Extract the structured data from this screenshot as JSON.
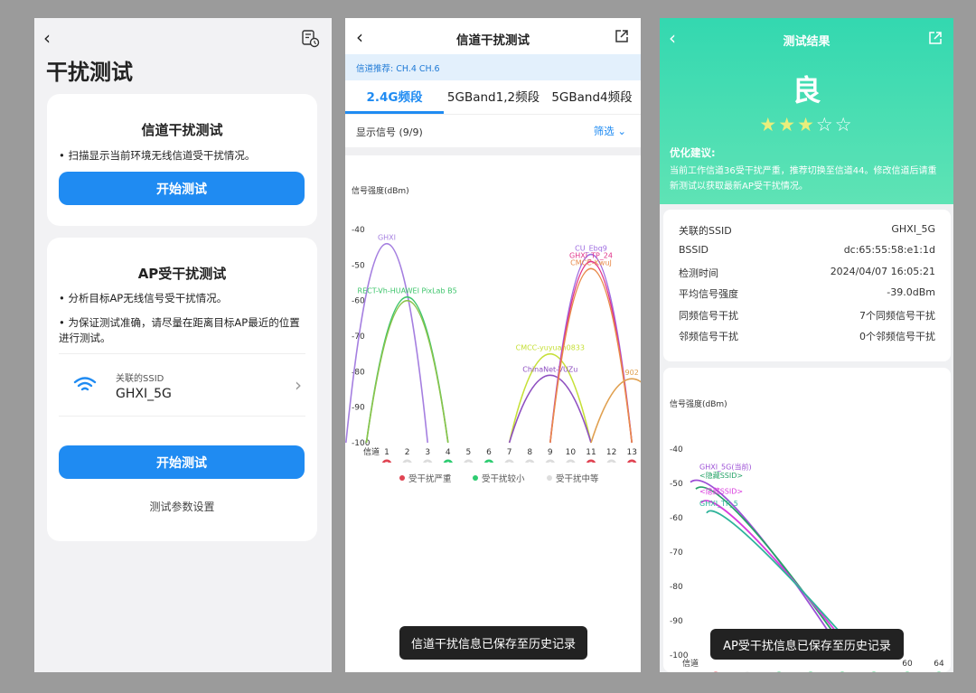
{
  "panel1": {
    "title": "干扰测试",
    "card1_title": "信道干扰测试",
    "card1_desc": "• 扫描显示当前环境无线信道受干扰情况。",
    "card1_button": "开始测试",
    "card2_title": "AP受干扰测试",
    "card2_desc1": "• 分析目标AP无线信号受干扰情况。",
    "card2_desc2": "• 为保证测试准确，请尽量在距离目标AP最近的位置进行测试。",
    "ssid_label": "关联的SSID",
    "ssid_value": "GHXI_5G",
    "card2_button": "开始测试",
    "settings_link": "测试参数设置"
  },
  "panel2": {
    "title": "信道干扰测试",
    "recommend": "信道推荐: CH.4 CH.6",
    "tabs": [
      "2.4G频段",
      "5GBand1,2频段",
      "5GBand4频段"
    ],
    "signal_count": "显示信号 (9/9)",
    "filter": "筛选",
    "ylabel": "信号强度(dBm)",
    "x_axis_label": "信道",
    "yticks": [
      "-40",
      "-50",
      "-60",
      "-70",
      "-80",
      "-90",
      "-100"
    ],
    "xticks": [
      "1",
      "2",
      "3",
      "4",
      "5",
      "6",
      "7",
      "8",
      "9",
      "10",
      "11",
      "12",
      "13"
    ],
    "badges": [
      "3",
      "0",
      "0",
      "0",
      "0",
      "0",
      "0",
      "0",
      "0",
      "0",
      "3",
      "0",
      "3"
    ],
    "legend": [
      "受干扰严重",
      "受干扰较小",
      "受干扰中等"
    ],
    "toast": "信道干扰信息已保存至历史记录",
    "legend_colors": {
      "severe": "#e04452",
      "small": "#2ecc71",
      "medium": "#dddddd"
    }
  },
  "panel3": {
    "title": "测试结果",
    "grade": "良",
    "stars": [
      "★",
      "★",
      "★",
      "☆",
      "☆"
    ],
    "advice_title": "优化建议:",
    "advice": "当前工作信道36受干扰严重，推荐切换至信道44。修改信道后请重新测试以获取最新AP受干扰情况。",
    "rows": [
      {
        "k": "关联的SSID",
        "v": "GHXI_5G"
      },
      {
        "k": "BSSID",
        "v": "dc:65:55:58:e1:1d"
      },
      {
        "k": "检测时间",
        "v": "2024/04/07 16:05:21"
      },
      {
        "k": "平均信号强度",
        "v": "-39.0dBm"
      },
      {
        "k": "同频信号干扰",
        "v": "7个同频信号干扰"
      },
      {
        "k": "邻频信号干扰",
        "v": "0个邻频信号干扰"
      }
    ],
    "ylabel": "信号强度(dBm)",
    "yticks": [
      "-40",
      "-50",
      "-60",
      "-70",
      "-80",
      "-90",
      "-100"
    ],
    "x_axis_label": "信道",
    "xticks_visible": [
      "60",
      "64"
    ],
    "toast": "AP受干扰信息已保存至历史记录",
    "header_color": "#3dd6b0"
  },
  "chart_data": [
    {
      "type": "line",
      "title": "",
      "ylabel": "信号强度(dBm)",
      "xlabel": "信道",
      "ylim": [
        -100,
        -40
      ],
      "x": [
        1,
        2,
        3,
        4,
        5,
        6,
        7,
        8,
        9,
        10,
        11,
        12,
        13
      ],
      "series": [
        {
          "name": "GHXI",
          "center": 1,
          "peak": -44,
          "color": "#a57fe0"
        },
        {
          "name": "RECT-Vh-HUAWEI PixLab B5",
          "center": 2,
          "peak": -59,
          "color": "#3cc46a"
        },
        {
          "name": "",
          "center": 2,
          "peak": -60,
          "color": "#8bc34a"
        },
        {
          "name": "CMCC-yuyuan0833",
          "center": 9,
          "peak": -75,
          "color": "#c6e038"
        },
        {
          "name": "ChinaNet-VUZu",
          "center": 9,
          "peak": -81,
          "color": "#8e4fc0"
        },
        {
          "name": "CU_Ebq9",
          "center": 11,
          "peak": -47,
          "color": "#9d6be0"
        },
        {
          "name": "GHXI_TP_24",
          "center": 11,
          "peak": -49,
          "color": "#e0348a"
        },
        {
          "name": "CMCC-KwuJ",
          "center": 11,
          "peak": -51,
          "color": "#e88a4a"
        },
        {
          "name": "902",
          "center": 13,
          "peak": -82,
          "color": "#e0a050"
        }
      ]
    },
    {
      "type": "line",
      "title": "",
      "ylabel": "信号强度(dBm)",
      "xlabel": "信道",
      "ylim": [
        -100,
        -40
      ],
      "series": [
        {
          "name": "GHXI_5G(当前)",
          "peak": -47,
          "color": "#9c4fd6"
        },
        {
          "name": "<隐藏SSID>",
          "peak": -49,
          "color": "#27a368"
        },
        {
          "name": "<隐藏SSID>",
          "peak": -53,
          "color": "#d83cdd"
        },
        {
          "name": "GHXI_TP_5",
          "peak": -56,
          "color": "#2fb39a"
        }
      ]
    }
  ]
}
